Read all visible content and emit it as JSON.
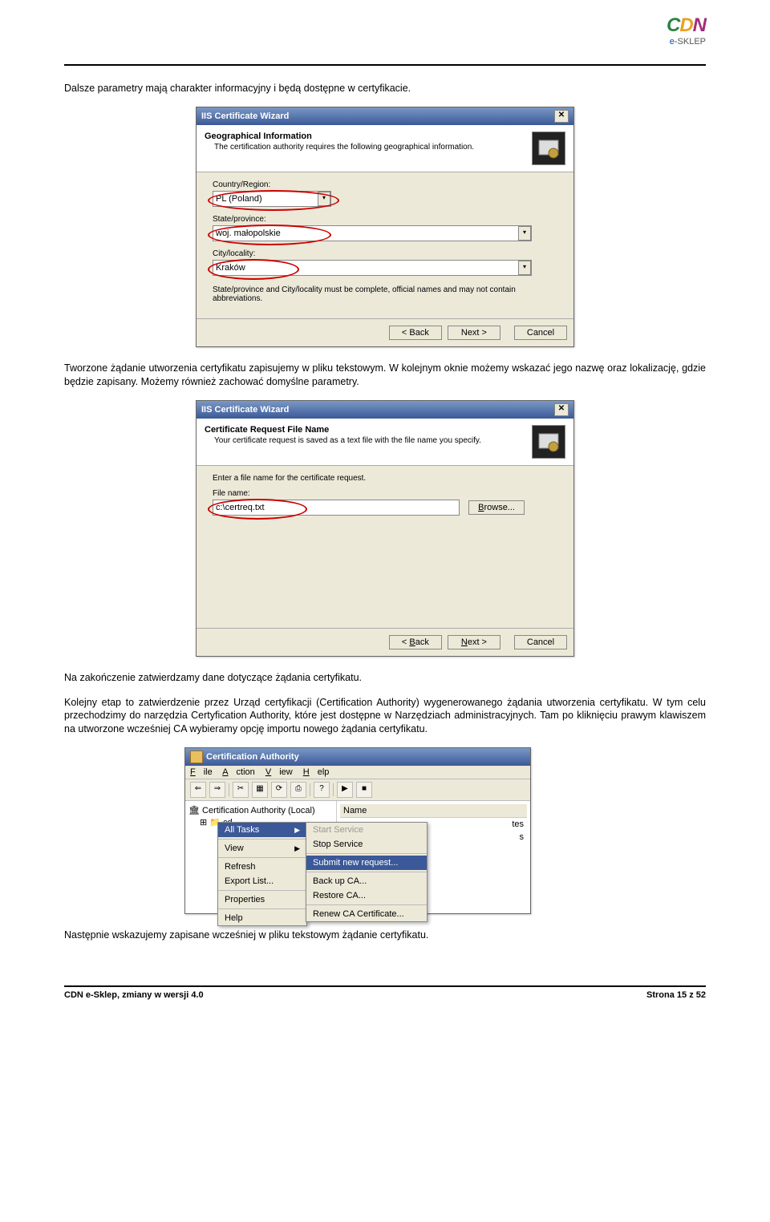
{
  "logo": {
    "c": "C",
    "d": "D",
    "n": "N",
    "sub_e": "e-",
    "sub_sklep": "SKLEP"
  },
  "para1": "Dalsze parametry mają charakter informacyjny i będą dostępne w certyfikacie.",
  "wizard1": {
    "window_title": "IIS Certificate Wizard",
    "header_title": "Geographical Information",
    "header_desc": "The certification authority requires the following geographical information.",
    "country_label": "Country/Region:",
    "country_value": "PL (Poland)",
    "state_label": "State/province:",
    "state_value": "woj. małopolskie",
    "city_label": "City/locality:",
    "city_value": "Kraków",
    "note": "State/province and City/locality must be complete, official names and may not contain abbreviations.",
    "back": "< Back",
    "next": "Next >",
    "cancel": "Cancel"
  },
  "para2": "Tworzone żądanie utworzenia certyfikatu zapisujemy w pliku tekstowym. W kolejnym oknie możemy wskazać jego nazwę oraz lokalizację, gdzie będzie zapisany. Możemy również zachować domyślne parametry.",
  "wizard2": {
    "window_title": "IIS Certificate Wizard",
    "header_title": "Certificate Request File Name",
    "header_desc": "Your certificate request is saved as a text file with the file name you specify.",
    "enter_label": "Enter a file name for the certificate request.",
    "file_label": "File name:",
    "file_value": "c:\\certreq.txt",
    "browse": "Browse...",
    "back": "< Back",
    "next": "Next >",
    "cancel": "Cancel"
  },
  "para3": "Na zakończenie zatwierdzamy dane dotyczące żądania certyfikatu.",
  "para4": "Kolejny etap to zatwierdzenie przez Urząd certyfikacji (Certification Authority) wygenerowanego żądania utworzenia certyfikatu. W tym celu przechodzimy do narzędzia Certyfication Authority, które jest dostępne w Narzędziach administracyjnych. Tam po kliknięciu prawym klawiszem na utworzone wcześniej CA wybieramy opcję importu nowego żądania certyfikatu.",
  "ca": {
    "title": "Certification Authority",
    "menu_file": "File",
    "menu_action": "Action",
    "menu_view": "View",
    "menu_help": "Help",
    "tree_root": "Certification Authority (Local)",
    "tree_child": "cd",
    "list_header": "Name",
    "list_item_suffix": "tes",
    "list_item_suffix2": "s",
    "ctx": {
      "all_tasks": "All Tasks",
      "view": "View",
      "refresh": "Refresh",
      "export": "Export List...",
      "properties": "Properties",
      "help": "Help"
    },
    "sub": {
      "start": "Start Service",
      "stop": "Stop Service",
      "submit": "Submit new request...",
      "backup": "Back up CA...",
      "restore": "Restore CA...",
      "renew": "Renew CA Certificate..."
    }
  },
  "para5": "Następnie wskazujemy zapisane wcześniej w pliku tekstowym żądanie certyfikatu.",
  "footer_left": "CDN e-Sklep, zmiany w wersji 4.0",
  "footer_right": "Strona 15 z 52"
}
